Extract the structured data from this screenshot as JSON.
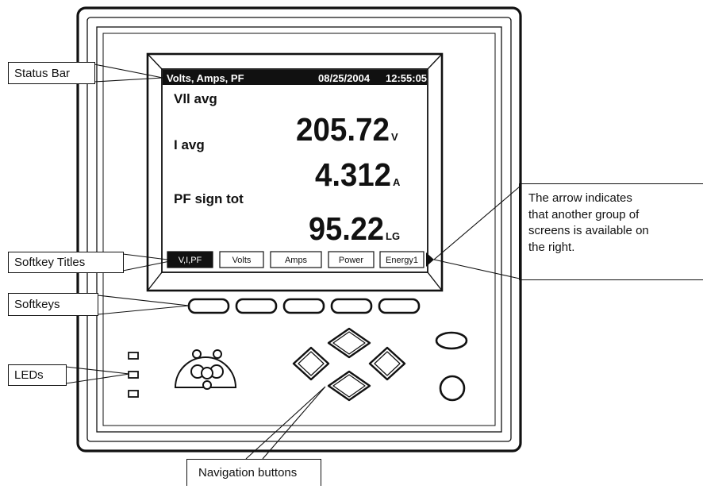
{
  "callouts": {
    "status_bar": "Status Bar",
    "softkey_titles": "Softkey Titles",
    "softkeys": "Softkeys",
    "leds": "LEDs",
    "navigation_buttons": "Navigation buttons",
    "arrow_note": [
      "The arrow indicates",
      "that another group of",
      "screens is available on",
      "the right."
    ]
  },
  "screen": {
    "title": "Volts, Amps, PF",
    "date": "08/25/2004",
    "time": "12:55:05",
    "readings": [
      {
        "label": "Vll avg",
        "value": "205.72",
        "unit": "V"
      },
      {
        "label": "I avg",
        "value": "4.312",
        "unit": "A"
      },
      {
        "label": "PF sign tot",
        "value": "95.22",
        "unit": "LG"
      }
    ],
    "softkey_titles": [
      "V,I,PF",
      "Volts",
      "Amps",
      "Power",
      "Energy1"
    ],
    "selected_softkey": 0
  },
  "colors": {
    "line": "#111111",
    "selected_softkey_fill": "#111111",
    "selected_softkey_text": "#ffffff"
  }
}
